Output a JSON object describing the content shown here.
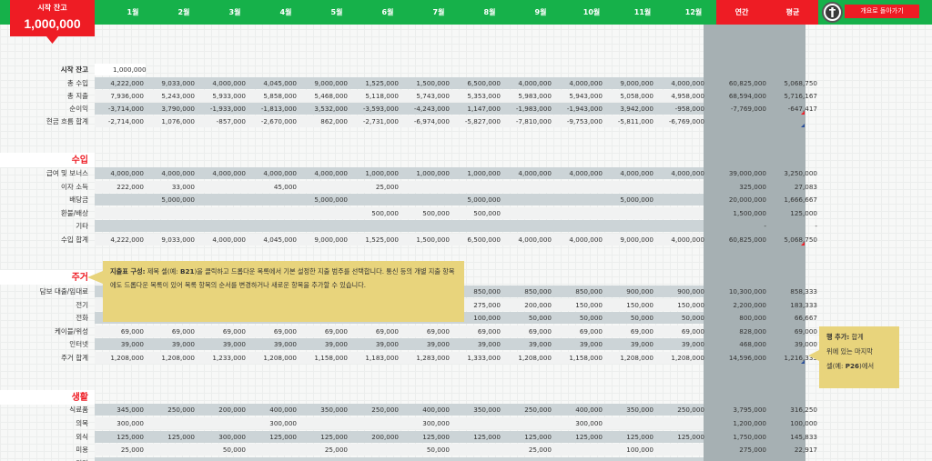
{
  "header": {
    "start_label": "시작 잔고",
    "start_value": "1,000,000",
    "months": [
      "1월",
      "2월",
      "3월",
      "4월",
      "5월",
      "6월",
      "7월",
      "8월",
      "9월",
      "10월",
      "11월",
      "12월"
    ],
    "annual_label": "연간",
    "average_label": "평균",
    "back_button": "개요로 돌아가기"
  },
  "summary": {
    "start_row": {
      "label": "시작 잔고",
      "value": "1,000,000"
    },
    "rows": [
      {
        "label": "총 수입",
        "band": "dark",
        "values": [
          "4,222,000",
          "9,033,000",
          "4,000,000",
          "4,045,000",
          "9,000,000",
          "1,525,000",
          "1,500,000",
          "6,500,000",
          "4,000,000",
          "4,000,000",
          "9,000,000",
          "4,000,000"
        ],
        "annual": "60,825,000",
        "average": "5,068,750"
      },
      {
        "label": "총 지출",
        "band": "light",
        "values": [
          "7,936,000",
          "5,243,000",
          "5,933,000",
          "5,858,000",
          "5,468,000",
          "5,118,000",
          "5,743,000",
          "5,353,000",
          "5,983,000",
          "5,943,000",
          "5,058,000",
          "4,958,000"
        ],
        "annual": "68,594,000",
        "average": "5,716,167"
      },
      {
        "label": "순이익",
        "band": "dark",
        "values": [
          "-3,714,000",
          "3,790,000",
          "-1,933,000",
          "-1,813,000",
          "3,532,000",
          "-3,593,000",
          "-4,243,000",
          "1,147,000",
          "-1,983,000",
          "-1,943,000",
          "3,942,000",
          "-958,000"
        ],
        "annual": "-7,769,000",
        "average": "-647,417"
      },
      {
        "label": "현금 흐름 합계",
        "band": "light",
        "values": [
          "-2,714,000",
          "1,076,000",
          "-857,000",
          "-2,670,000",
          "862,000",
          "-2,731,000",
          "-6,974,000",
          "-5,827,000",
          "-7,810,000",
          "-9,753,000",
          "-5,811,000",
          "-6,769,000"
        ],
        "annual": "",
        "average": ""
      }
    ]
  },
  "income": {
    "title": "수입",
    "rows": [
      {
        "label": "급여 및 보너스",
        "band": "dark",
        "values": [
          "4,000,000",
          "4,000,000",
          "4,000,000",
          "4,000,000",
          "4,000,000",
          "1,000,000",
          "1,000,000",
          "1,000,000",
          "4,000,000",
          "4,000,000",
          "4,000,000",
          "4,000,000"
        ],
        "annual": "39,000,000",
        "average": "3,250,000"
      },
      {
        "label": "이자 소득",
        "band": "light",
        "values": [
          "222,000",
          "33,000",
          "",
          "45,000",
          "",
          "25,000",
          "",
          "",
          "",
          "",
          "",
          ""
        ],
        "annual": "325,000",
        "average": "27,083"
      },
      {
        "label": "배당금",
        "band": "dark",
        "values": [
          "",
          "5,000,000",
          "",
          "",
          "5,000,000",
          "",
          "",
          "5,000,000",
          "",
          "",
          "5,000,000",
          ""
        ],
        "annual": "20,000,000",
        "average": "1,666,667"
      },
      {
        "label": "환불/배상",
        "band": "light",
        "values": [
          "",
          "",
          "",
          "",
          "",
          "500,000",
          "500,000",
          "500,000",
          "",
          "",
          "",
          ""
        ],
        "annual": "1,500,000",
        "average": "125,000"
      },
      {
        "label": "기타",
        "band": "dark",
        "values": [
          "",
          "",
          "",
          "",
          "",
          "",
          "",
          "",
          "",
          "",
          "",
          ""
        ],
        "annual": "-",
        "average": "-"
      },
      {
        "label": "수입 합계",
        "band": "light",
        "values": [
          "4,222,000",
          "9,033,000",
          "4,000,000",
          "4,045,000",
          "9,000,000",
          "1,525,000",
          "1,500,000",
          "6,500,000",
          "4,000,000",
          "4,000,000",
          "9,000,000",
          "4,000,000"
        ],
        "annual": "60,825,000",
        "average": "5,068,750"
      }
    ]
  },
  "housing": {
    "title": "주거",
    "rows": [
      {
        "label": "담보 대출/임대료",
        "band": "dark",
        "values": [
          "",
          "",
          "",
          "",
          "",
          "",
          "",
          "850,000",
          "850,000",
          "850,000",
          "900,000",
          "900,000"
        ],
        "annual": "10,300,000",
        "average": "858,333"
      },
      {
        "label": "전기",
        "band": "light",
        "values": [
          "",
          "",
          "",
          "",
          "",
          "",
          "",
          "275,000",
          "200,000",
          "150,000",
          "150,000",
          "150,000"
        ],
        "annual": "2,200,000",
        "average": "183,333"
      },
      {
        "label": "전화",
        "band": "dark",
        "values": [
          "",
          "",
          "",
          "",
          "",
          "",
          "",
          "100,000",
          "50,000",
          "50,000",
          "50,000",
          "50,000"
        ],
        "annual": "800,000",
        "average": "66,667"
      },
      {
        "label": "케이블/위성",
        "band": "light",
        "values": [
          "69,000",
          "69,000",
          "69,000",
          "69,000",
          "69,000",
          "69,000",
          "69,000",
          "69,000",
          "69,000",
          "69,000",
          "69,000",
          "69,000"
        ],
        "annual": "828,000",
        "average": "69,000"
      },
      {
        "label": "인터넷",
        "band": "dark",
        "values": [
          "39,000",
          "39,000",
          "39,000",
          "39,000",
          "39,000",
          "39,000",
          "39,000",
          "39,000",
          "39,000",
          "39,000",
          "39,000",
          "39,000"
        ],
        "annual": "468,000",
        "average": "39,000"
      },
      {
        "label": "주거 합계",
        "band": "light",
        "values": [
          "1,208,000",
          "1,208,000",
          "1,233,000",
          "1,208,000",
          "1,158,000",
          "1,183,000",
          "1,283,000",
          "1,333,000",
          "1,208,000",
          "1,158,000",
          "1,208,000",
          "1,208,000"
        ],
        "annual": "14,596,000",
        "average": "1,216,333"
      }
    ]
  },
  "living": {
    "title": "생활",
    "rows": [
      {
        "label": "식료품",
        "band": "dark",
        "values": [
          "345,000",
          "250,000",
          "200,000",
          "400,000",
          "350,000",
          "250,000",
          "400,000",
          "350,000",
          "250,000",
          "400,000",
          "350,000",
          "250,000"
        ],
        "annual": "3,795,000",
        "average": "316,250"
      },
      {
        "label": "의복",
        "band": "light",
        "values": [
          "300,000",
          "",
          "",
          "300,000",
          "",
          "",
          "300,000",
          "",
          "",
          "300,000",
          "",
          ""
        ],
        "annual": "1,200,000",
        "average": "100,000"
      },
      {
        "label": "외식",
        "band": "dark",
        "values": [
          "125,000",
          "125,000",
          "300,000",
          "125,000",
          "125,000",
          "200,000",
          "125,000",
          "125,000",
          "125,000",
          "125,000",
          "125,000",
          "125,000"
        ],
        "annual": "1,750,000",
        "average": "145,833"
      },
      {
        "label": "미용",
        "band": "light",
        "values": [
          "25,000",
          "",
          "50,000",
          "",
          "25,000",
          "",
          "50,000",
          "",
          "25,000",
          "",
          "100,000",
          ""
        ],
        "annual": "275,000",
        "average": "22,917"
      },
      {
        "label": "기타",
        "band": "dark",
        "values": [
          "",
          "",
          "",
          "",
          "",
          "",
          "",
          "",
          "",
          "",
          "",
          ""
        ],
        "annual": "",
        "average": ""
      }
    ]
  },
  "tooltips": {
    "expense_title": "지출표 구성:",
    "expense_text_1": " 제목 셀(예: ",
    "expense_ref": "B21",
    "expense_text_2": ")을 클릭하고 드롭다운 목록에서 기본 설정한 지출 범주를 선택합니다. 통신 등의 개별 지출 항목에도 드롭다운 목록이 있어 목록 항목의 순서를 변경하거나 새로운 항목을 추가할 수 있습니다.",
    "row_title": "행 추가:",
    "row_text_1": " 합계",
    "row_text_2": "위에 있는 마지막",
    "row_text_3": "셀(예: ",
    "row_ref": "P26",
    "row_text_4": ")에서"
  },
  "colors": {
    "header_green": "#16b14a",
    "accent_red": "#ee1c24",
    "tooltip_yellow": "#e8d47c",
    "panel_gray": "#a6b0b3"
  }
}
